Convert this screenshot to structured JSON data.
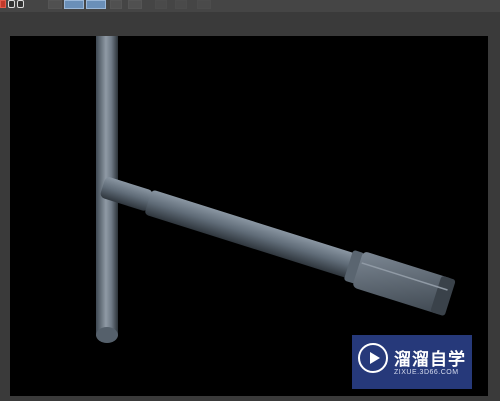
{
  "toolbar": {
    "icons": [
      "close-icon",
      "view-icon",
      "tool-icon",
      "dim-tool-icon"
    ]
  },
  "viewport": {
    "background": "#000000",
    "object": "rod-assembly"
  },
  "watermark": {
    "title": "溜溜自学",
    "subtitle": "ZIXUE.3D66.COM",
    "background": "#26397a"
  }
}
